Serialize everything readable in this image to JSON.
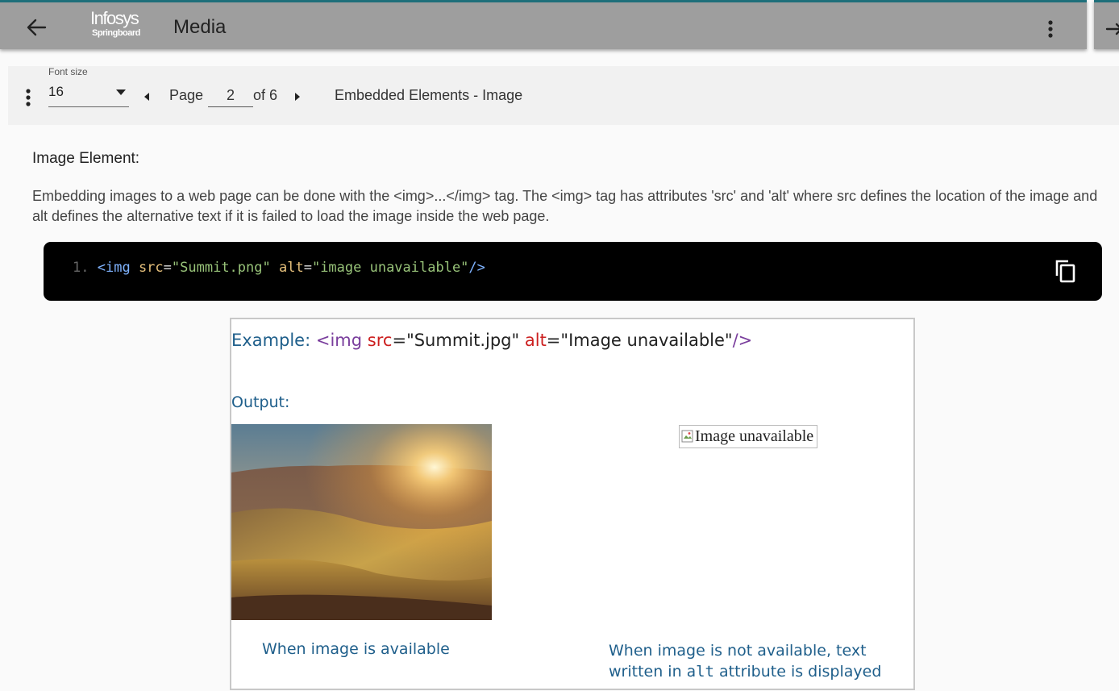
{
  "appbar": {
    "title": "Media",
    "logo_line1": "Infosys",
    "logo_line2": "Springboard"
  },
  "toolbar": {
    "font_size_label": "Font size",
    "font_size_value": "16",
    "page_label": "Page",
    "page_value": "2",
    "of_label": "of 6",
    "section_title": "Embedded Elements - Image"
  },
  "content": {
    "heading": "Image Element:",
    "paragraph": "Embedding images to a web page can be done with the <img>...</img> tag. The <img> tag has attributes 'src' and 'alt' where src defines the location of the image and alt defines the alternative text if it is failed to load the image inside the web page.",
    "code": {
      "line_number": "1.",
      "tag_open": "<img",
      "attr1": "src",
      "eq1": "=",
      "val1": "\"Summit.png\"",
      "attr2": "alt",
      "eq2": "=",
      "val2": "\"image unavailable\"",
      "tag_close": "/>"
    }
  },
  "example": {
    "label": "Example:",
    "tag_open": "<img",
    "attr1": "src",
    "eq1": "=",
    "val1": "\"Summit.jpg\"",
    "attr2": "alt",
    "eq2": "=",
    "val2": "\"Image unavailable\"",
    "tag_close": "/>",
    "output_label": "Output:",
    "broken_alt_text": "Image unavailable",
    "caption_available": "When image is available",
    "caption_unavailable_1": "When image is not available, text",
    "caption_unavailable_2a": "written in ",
    "caption_unavailable_2b": "alt",
    "caption_unavailable_2c": " attribute is displayed"
  },
  "icons": {
    "back": "arrow-left-icon",
    "menu": "more-vertical-icon",
    "exit": "exit-icon",
    "prev": "caret-left-icon",
    "next": "caret-right-icon",
    "copy": "copy-icon",
    "dropdown": "caret-down-icon"
  },
  "colors": {
    "appbar": "#9e9e9e",
    "appbar_accent": "#1e6f7a",
    "code_bg": "#000000",
    "example_blue": "#1f5f8b"
  }
}
